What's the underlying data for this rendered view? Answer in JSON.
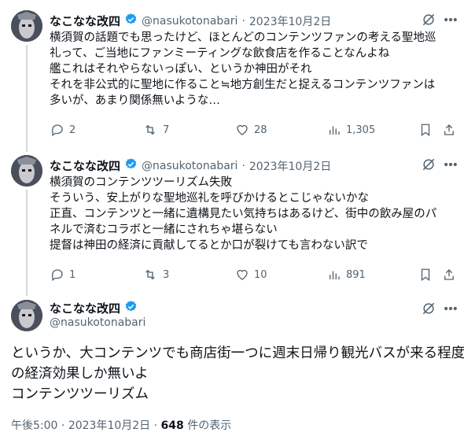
{
  "tweets": [
    {
      "author": "なこなな改四",
      "handle": "@nasukotonabari",
      "separator": "·",
      "date": "2023年10月2日",
      "lines": [
        "横須賀の話題でも思ったけど、ほとんどのコンテンツファンの考える聖地巡",
        "礼って、ご当地にファンミーティングな飲食店を作ることなんよね",
        "艦これはそれやらないっぽい、というか神田がそれ",
        "それを非公式的に聖地に作ること≒地方創生だと捉えるコンテンツファンは",
        "多いが、あまり関係無いような…"
      ],
      "stats": {
        "replies": "2",
        "reposts": "7",
        "likes": "28",
        "views": "1,305"
      }
    },
    {
      "author": "なこなな改四",
      "handle": "@nasukotonabari",
      "separator": "·",
      "date": "2023年10月2日",
      "lines": [
        "横須賀のコンテンツツーリズム失敗",
        "そういう、安上がりな聖地巡礼を呼びかけるとこじゃないかな",
        "正直、コンテンツと一緒に遺構見たい気持ちはあるけど、街中の飲み屋のパ",
        "ネルで済むコラボと一緒にされちゃ堪らない",
        "提督は神田の経済に貢献してるとか口が裂けても言わない訳で"
      ],
      "stats": {
        "replies": "1",
        "reposts": "3",
        "likes": "10",
        "views": "891"
      }
    }
  ],
  "main_tweet": {
    "author": "なこなな改四",
    "handle": "@nasukotonabari",
    "lines": [
      "というか、大コンテンツでも商店街一つに週末日帰り観光バスが来る程度",
      "の経済効果しか無いよ",
      "コンテンツツーリズム"
    ],
    "time": "午後5:00",
    "separator": "·",
    "date": "2023年10月2日",
    "views_count": "648",
    "views_label": "件の表示"
  },
  "colors": {
    "text": "#0f1419",
    "secondary": "#536471",
    "verified": "#1d9bf0",
    "line": "#cfd9de"
  },
  "icons": [
    "avatar",
    "verified-badge",
    "grok-icon",
    "more-icon",
    "reply-icon",
    "repost-icon",
    "like-icon",
    "views-icon",
    "bookmark-icon",
    "share-icon"
  ]
}
